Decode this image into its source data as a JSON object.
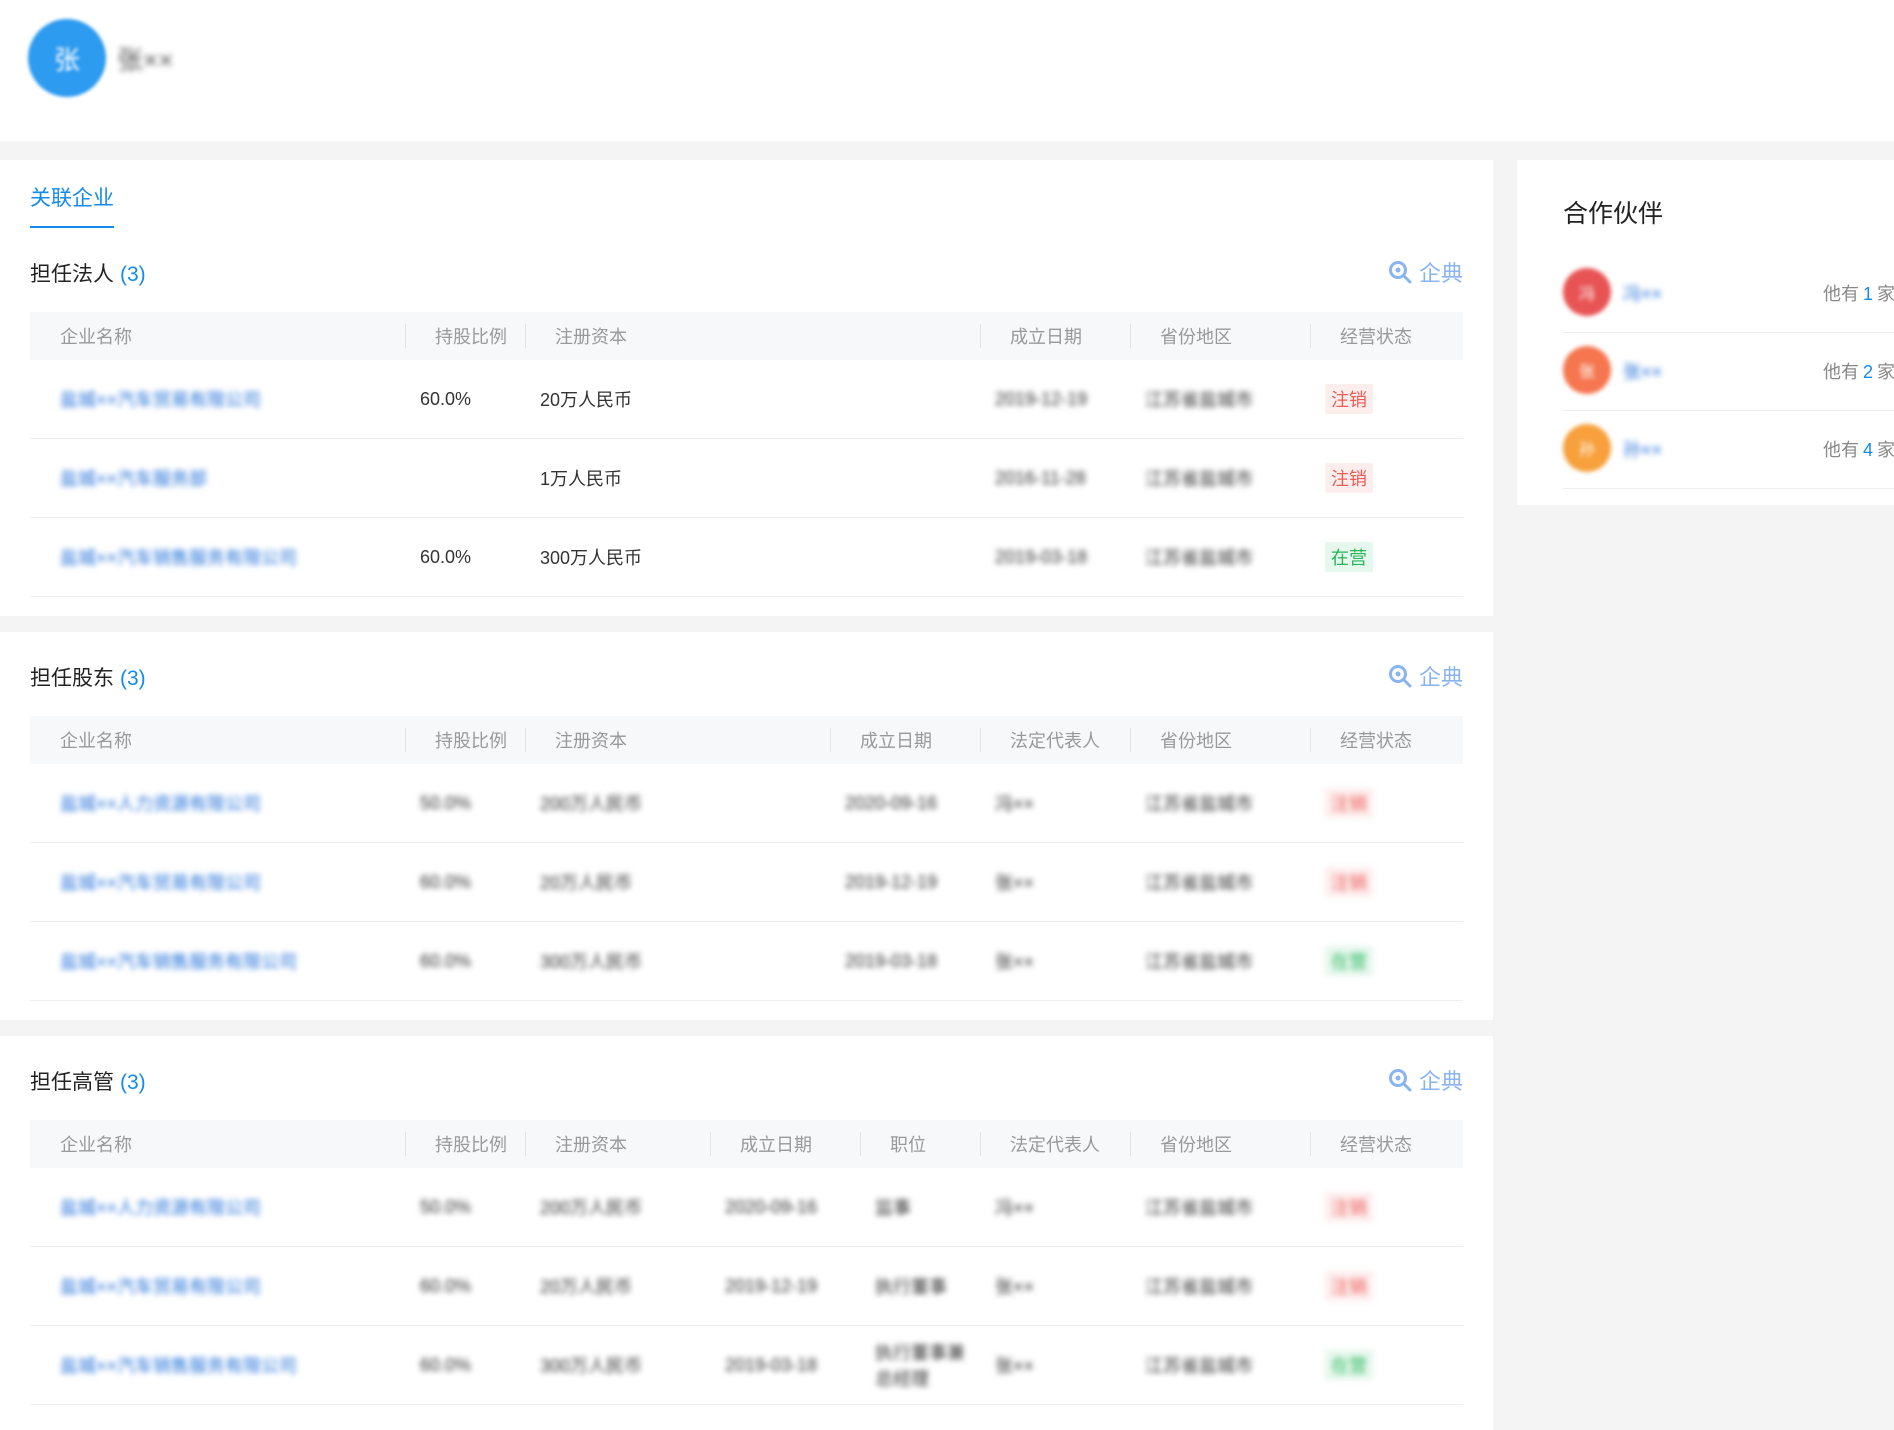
{
  "person": {
    "avatar_char": "张",
    "name": "张××"
  },
  "tab": "关联企业",
  "qidian_label": "企典",
  "sections": [
    {
      "title": "担任法人",
      "count": "(3)",
      "headers": [
        "企业名称",
        "持股比例",
        "注册资本",
        "成立日期",
        "省份地区",
        "经营状态"
      ],
      "rows": [
        {
          "name": "盐城××汽车贸易有限公司",
          "share": "60.0%",
          "capital": "20万人民币",
          "date": "2019-12-19",
          "region": "江苏省盐城市",
          "status": "注销",
          "status_type": "red"
        },
        {
          "name": "盐城××汽车服务部",
          "share": "",
          "capital": "1万人民币",
          "date": "2016-11-28",
          "region": "江苏省盐城市",
          "status": "注销",
          "status_type": "red"
        },
        {
          "name": "盐城××汽车销售服务有限公司",
          "share": "60.0%",
          "capital": "300万人民币",
          "date": "2019-03-18",
          "region": "江苏省盐城市",
          "status": "在营",
          "status_type": "green"
        }
      ]
    },
    {
      "title": "担任股东",
      "count": "(3)",
      "headers": [
        "企业名称",
        "持股比例",
        "注册资本",
        "成立日期",
        "法定代表人",
        "省份地区",
        "经营状态"
      ],
      "rows": [
        {
          "name": "盐城××人力资源有限公司",
          "share": "50.0%",
          "capital": "200万人民币",
          "date": "2020-09-16",
          "legal": "冯××",
          "region": "江苏省盐城市",
          "status": "注销",
          "status_type": "red"
        },
        {
          "name": "盐城××汽车贸易有限公司",
          "share": "60.0%",
          "capital": "20万人民币",
          "date": "2019-12-19",
          "legal": "张××",
          "region": "江苏省盐城市",
          "status": "注销",
          "status_type": "red"
        },
        {
          "name": "盐城××汽车销售服务有限公司",
          "share": "60.0%",
          "capital": "300万人民币",
          "date": "2019-03-18",
          "legal": "张××",
          "region": "江苏省盐城市",
          "status": "在营",
          "status_type": "green"
        }
      ]
    },
    {
      "title": "担任高管",
      "count": "(3)",
      "headers": [
        "企业名称",
        "持股比例",
        "注册资本",
        "成立日期",
        "职位",
        "法定代表人",
        "省份地区",
        "经营状态"
      ],
      "rows": [
        {
          "name": "盐城××人力资源有限公司",
          "share": "50.0%",
          "capital": "200万人民币",
          "date": "2020-09-16",
          "position": "监事",
          "legal": "冯××",
          "region": "江苏省盐城市",
          "status": "注销",
          "status_type": "red"
        },
        {
          "name": "盐城××汽车贸易有限公司",
          "share": "60.0%",
          "capital": "20万人民币",
          "date": "2019-12-19",
          "position": "执行董事",
          "legal": "张××",
          "region": "江苏省盐城市",
          "status": "注销",
          "status_type": "red"
        },
        {
          "name": "盐城××汽车销售服务有限公司",
          "share": "60.0%",
          "capital": "300万人民币",
          "date": "2019-03-18",
          "position": "执行董事兼总经理",
          "legal": "张××",
          "region": "江苏省盐城市",
          "status": "在营",
          "status_type": "green"
        }
      ]
    }
  ],
  "partners": {
    "title": "合作伙伴",
    "items": [
      {
        "avatar_char": "冯",
        "name": "冯××",
        "prefix": "他有",
        "count": "1",
        "suffix": "家关",
        "color": "#e85454"
      },
      {
        "avatar_char": "张",
        "name": "张××",
        "prefix": "他有",
        "count": "2",
        "suffix": "家关",
        "color": "#f5764f"
      },
      {
        "avatar_char": "孙",
        "name": "孙××",
        "prefix": "他有",
        "count": "4",
        "suffix": "家关",
        "color": "#f7a03c"
      }
    ]
  }
}
